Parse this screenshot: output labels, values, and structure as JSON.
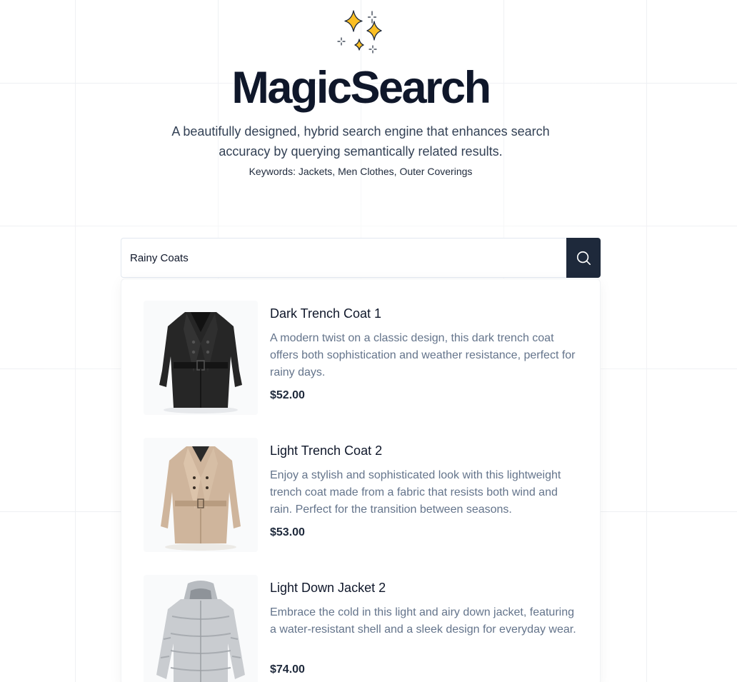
{
  "app": {
    "title": "MagicSearch",
    "subtitle": "A beautifully designed, hybrid search engine that enhances search accuracy by querying semantically related results.",
    "keywords": "Keywords: Jackets, Men Clothes, Outer Coverings",
    "logo_icon": "sparkles-icon",
    "accent_color": "#fbbf24"
  },
  "search": {
    "value": "Rainy Coats",
    "button_icon": "search-icon",
    "button_color": "#1e293b"
  },
  "results": [
    {
      "title": "Dark Trench Coat 1",
      "description": "A modern twist on a classic design, this dark trench coat offers both sophistication and weather resistance, perfect for rainy days.",
      "price": "$52.00",
      "image": "dark-trench-coat-image"
    },
    {
      "title": "Light Trench Coat 2",
      "description": "Enjoy a stylish and sophisticated look with this lightweight trench coat made from a fabric that resists both wind and rain. Perfect for the transition between seasons.",
      "price": "$53.00",
      "image": "light-trench-coat-image"
    },
    {
      "title": "Light Down Jacket 2",
      "description": "Embrace the cold in this light and airy down jacket, featuring a water-resistant shell and a sleek design for everyday wear.",
      "price": "$74.00",
      "image": "down-jacket-image"
    }
  ]
}
